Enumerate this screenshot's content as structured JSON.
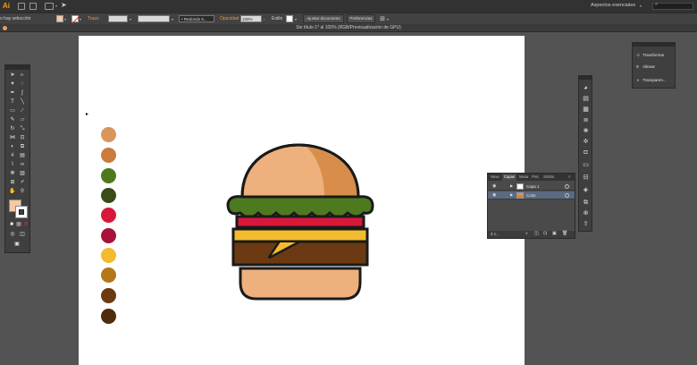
{
  "menubar": {
    "logo": "Ai",
    "workspace": "Aspectos esenciales",
    "search_icon": "search-icon"
  },
  "controlbar": {
    "selection_text": "o hay selección",
    "stroke_label": "Trazo",
    "brush_value": "Redondo 5...",
    "opacity_label": "Opacidad",
    "opacity_value": "100%",
    "style_label": "Estilo",
    "doc_setup_button": "Ajustar documento",
    "prefs_button": "Preferencias"
  },
  "document": {
    "tab_title": "Sin título-1* al 100% (RGB/Previsualización de GPU)"
  },
  "colors": {
    "fill": "#f4c9a3",
    "swatches": [
      "#d9965c",
      "#c97c3e",
      "#4d7a1e",
      "#3a4c1a",
      "#d8183a",
      "#a8123a",
      "#f2bc2e",
      "#b47818",
      "#6b3a12",
      "#4f2c0c"
    ]
  },
  "mini_panel": {
    "items": [
      {
        "label": "Transformar",
        "icon": "transform-icon"
      },
      {
        "label": "Alinear",
        "icon": "align-icon"
      },
      {
        "label": "Transparen...",
        "icon": "transparency-icon"
      }
    ]
  },
  "layers_panel": {
    "tabs": [
      "Nave",
      "Capas",
      "Mesa",
      "Pinc",
      "Símbo"
    ],
    "active_tab": "Capas",
    "rows": [
      {
        "name": "Capa 1"
      },
      {
        "name": "Color"
      }
    ],
    "count": "2 c..."
  }
}
